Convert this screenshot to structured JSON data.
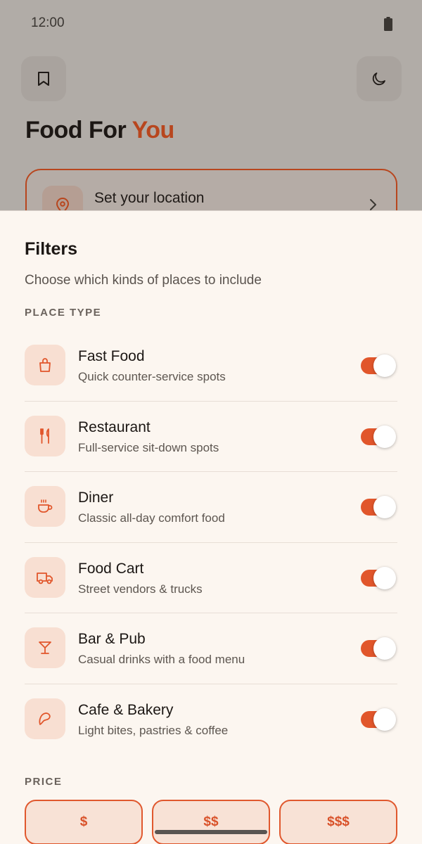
{
  "status_bar": {
    "time": "12:00"
  },
  "app": {
    "title_main": "Food For ",
    "title_accent": "You",
    "location_label": "Set your location"
  },
  "filters": {
    "title": "Filters",
    "subtitle": "Choose which kinds of places to include",
    "place_type_label": "PLACE TYPE",
    "items": [
      {
        "name": "Fast Food",
        "desc": "Quick counter-service spots",
        "icon": "shopping-bag-icon",
        "enabled": true
      },
      {
        "name": "Restaurant",
        "desc": "Full-service sit-down spots",
        "icon": "fork-knife-icon",
        "enabled": true
      },
      {
        "name": "Diner",
        "desc": "Classic all-day comfort food",
        "icon": "coffee-cup-icon",
        "enabled": true
      },
      {
        "name": "Food Cart",
        "desc": "Street vendors & trucks",
        "icon": "truck-icon",
        "enabled": true
      },
      {
        "name": "Bar & Pub",
        "desc": "Casual drinks with a food menu",
        "icon": "cocktail-glass-icon",
        "enabled": true
      },
      {
        "name": "Cafe & Bakery",
        "desc": "Light bites, pastries & coffee",
        "icon": "croissant-icon",
        "enabled": true
      }
    ],
    "price_label": "PRICE",
    "price_options": [
      "$",
      "$$",
      "$$$"
    ]
  },
  "colors": {
    "accent": "#e1562b",
    "accent_dark": "#b8461e",
    "sheet_bg": "#fcf6f0",
    "icon_bg": "#f8dfd2"
  }
}
